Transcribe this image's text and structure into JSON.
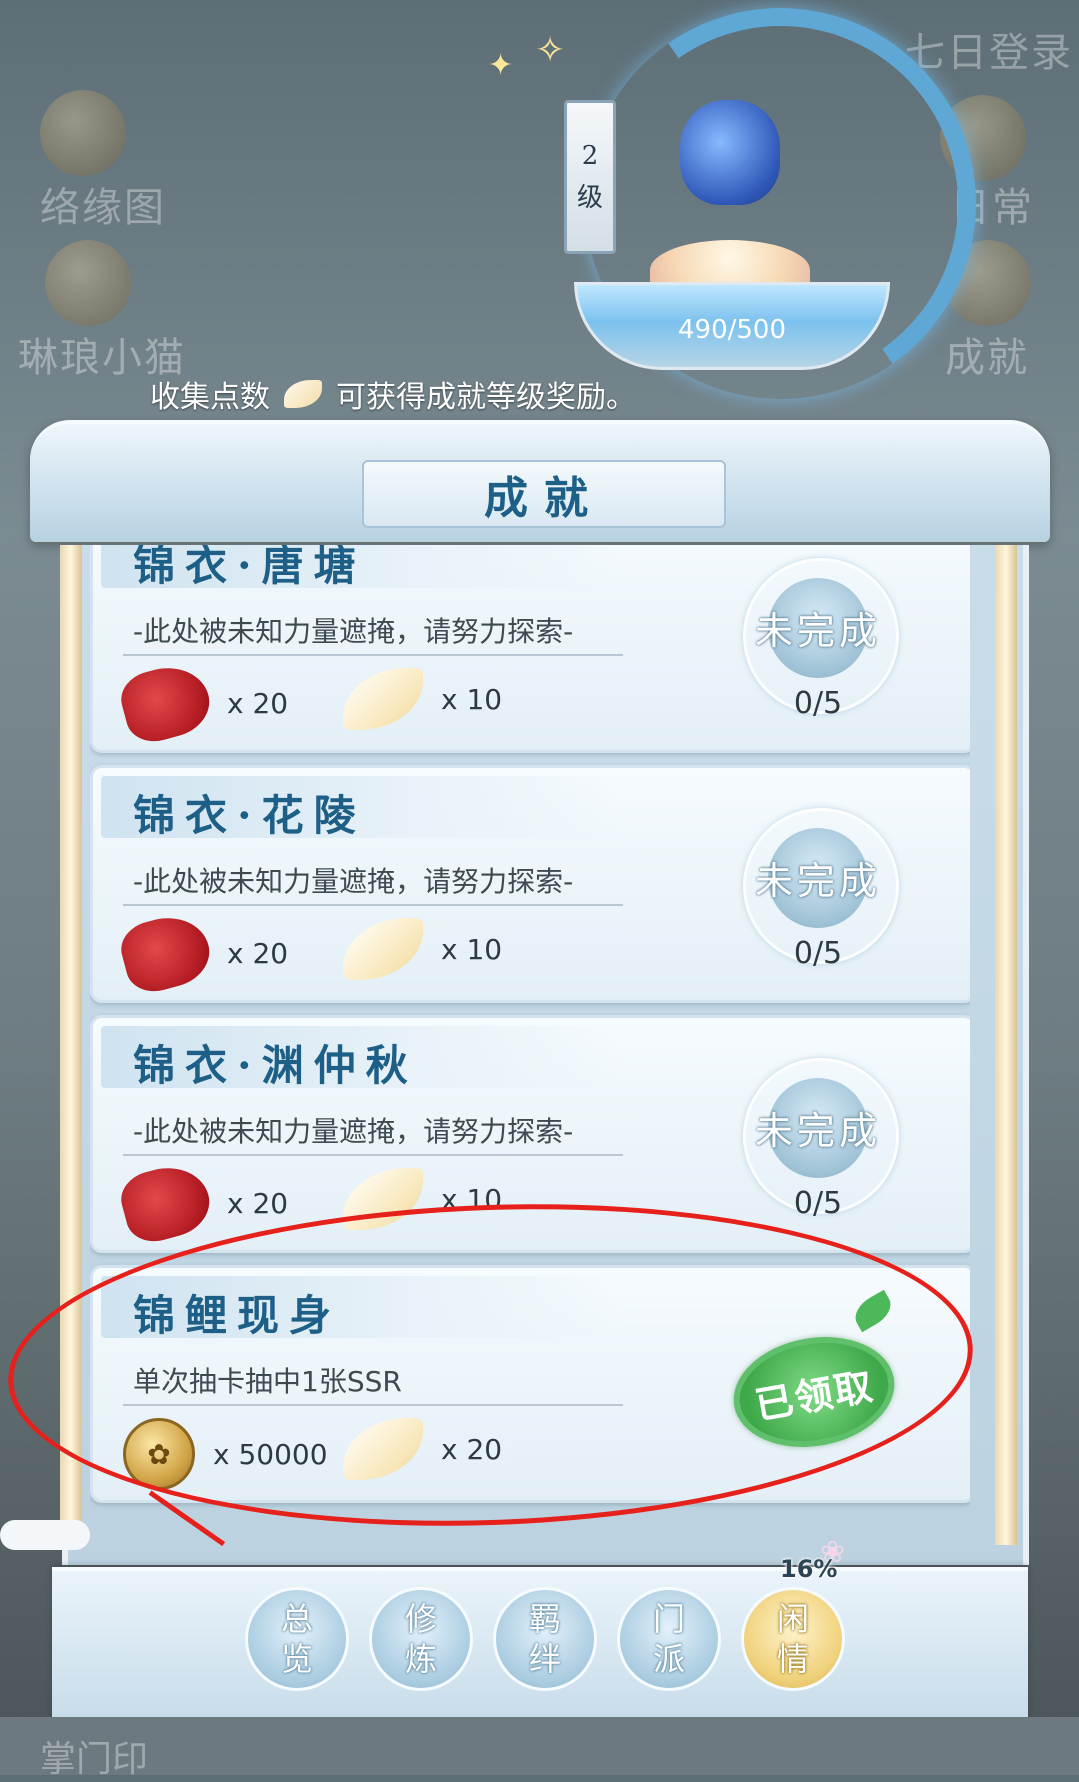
{
  "background": {
    "side_labels_left": [
      "络缘图",
      "琳琅小猫"
    ],
    "side_labels_right": [
      "七日登录",
      "日常",
      "成就"
    ],
    "bottom_label": "掌门印"
  },
  "header": {
    "level_number": "2",
    "level_unit": "级",
    "points_text": "490/500",
    "points_current": 490,
    "points_max": 500,
    "hint_prefix": "收集点数",
    "hint_suffix": "可获得成就等级奖励。"
  },
  "panel": {
    "title": "成就"
  },
  "achievements": [
    {
      "title": "锦衣·唐塘",
      "description": "-此处被未知力量遮掩，请努力探索-",
      "rewards": [
        {
          "icon": "red-ribbon-icon",
          "qty": "x 20"
        },
        {
          "icon": "petal-icon",
          "qty": "x 10"
        }
      ],
      "status": "未完成",
      "progress": "0/5"
    },
    {
      "title": "锦衣·花陵",
      "description": "-此处被未知力量遮掩，请努力探索-",
      "rewards": [
        {
          "icon": "red-ribbon-icon",
          "qty": "x 20"
        },
        {
          "icon": "petal-icon",
          "qty": "x 10"
        }
      ],
      "status": "未完成",
      "progress": "0/5"
    },
    {
      "title": "锦衣·渊仲秋",
      "description": "-此处被未知力量遮掩，请努力探索-",
      "rewards": [
        {
          "icon": "red-ribbon-icon",
          "qty": "x 20"
        },
        {
          "icon": "petal-icon",
          "qty": "x 10"
        }
      ],
      "status": "未完成",
      "progress": "0/5"
    },
    {
      "title": "锦鲤现身",
      "description": "单次抽卡抽中1张SSR",
      "rewards": [
        {
          "icon": "coin-icon",
          "qty": "x 50000"
        },
        {
          "icon": "petal-icon",
          "qty": "x 20"
        }
      ],
      "status": "已领取",
      "progress": ""
    }
  ],
  "tabs": [
    {
      "label_top": "总",
      "label_bottom": "览"
    },
    {
      "label_top": "修",
      "label_bottom": "炼"
    },
    {
      "label_top": "羁",
      "label_bottom": "绊"
    },
    {
      "label_top": "门",
      "label_bottom": "派"
    },
    {
      "label_top": "闲",
      "label_bottom": "情"
    }
  ],
  "active_tab_index": 4,
  "active_tab_badge": "16%",
  "colors": {
    "accent_blue": "#1d5f86",
    "claimed_green": "#3fa849",
    "annotation_red": "#e6201a"
  }
}
